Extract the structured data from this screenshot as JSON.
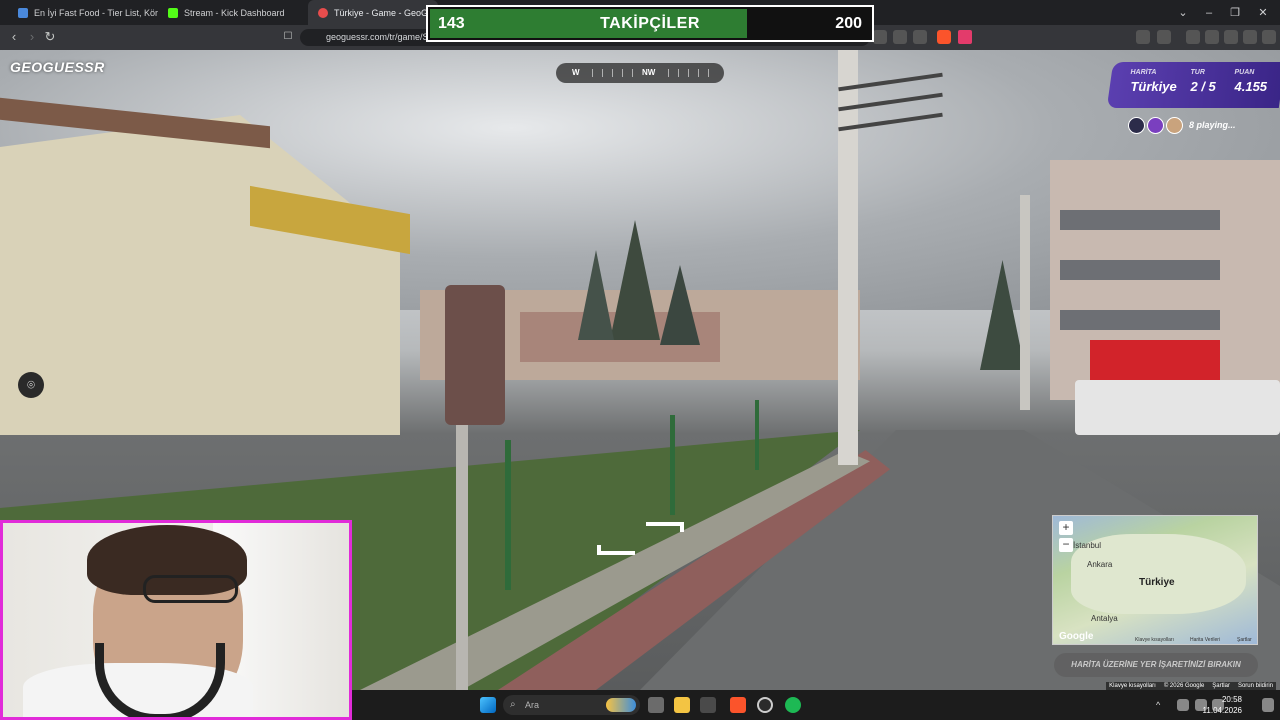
{
  "browser": {
    "tabs": [
      {
        "label": "En İyi Fast Food - Tier List, Kör Sıralaı"
      },
      {
        "label": "Stream - Kick Dashboard"
      },
      {
        "label": "Türkiye - Game - GeoGuessr"
      }
    ],
    "url": "geoguessr.com/tr/game/S"
  },
  "followers_overlay": {
    "current": "143",
    "title": "TAKİPÇİLER",
    "goal": "200",
    "progress": 0.715
  },
  "game": {
    "logo": "GEOGUESSR",
    "compass": {
      "west": "W",
      "current": "NW"
    },
    "status": {
      "map_label": "HARİTA",
      "map_value": "Türkiye",
      "round_label": "TUR",
      "round_value": "2 / 5",
      "score_label": "PUAN",
      "score_value": "4.155"
    },
    "playing": "8 playing...",
    "minimap": {
      "places": [
        "İstanbul",
        "Ankara",
        "Türkiye",
        "Antalya"
      ],
      "google": "Google",
      "footer": [
        "Klavye kısayolları",
        "Harita Verileri",
        "Şartlar"
      ]
    },
    "guess_button": "HARİTA ÜZERİNE YER İŞARETİNİZİ BIRAKIN",
    "street_footer": [
      "Klavye kısayolları",
      "© 2026 Google",
      "Şartlar",
      "Sorun bildirin"
    ]
  },
  "taskbar": {
    "search_placeholder": "Ara",
    "time": "20:58",
    "date": "11.04.2026"
  },
  "colors": {
    "accent": "#2e7d32",
    "webcam_border": "#e12bd9",
    "status_bg": "#4b32a0"
  }
}
